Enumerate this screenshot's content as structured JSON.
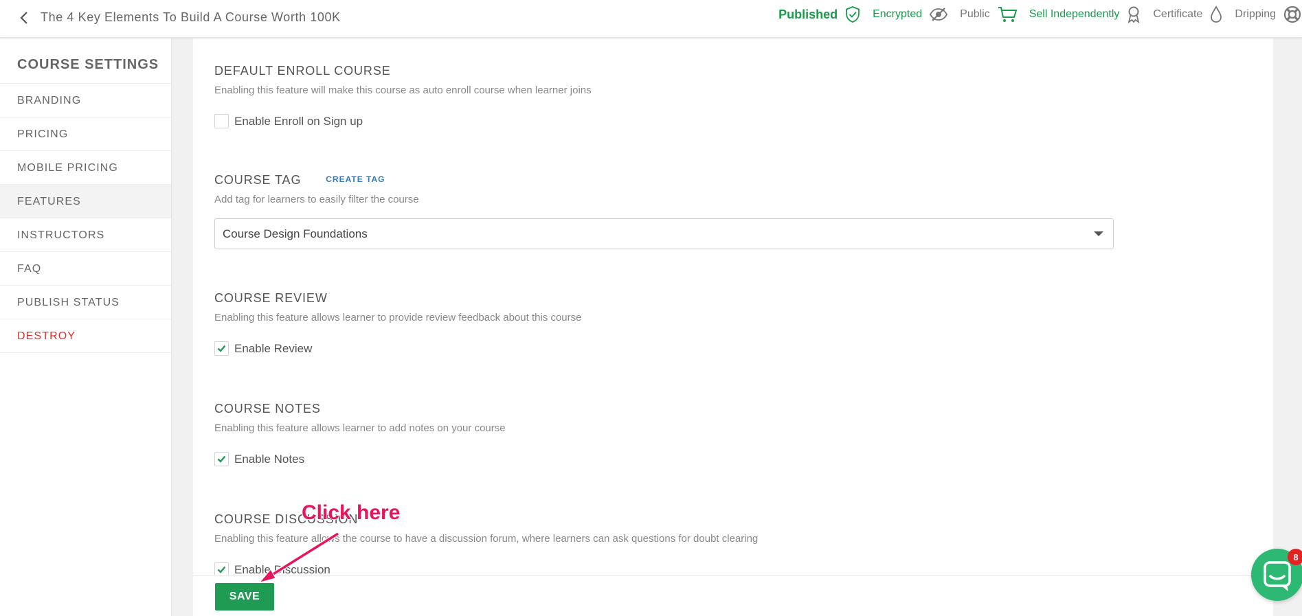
{
  "header": {
    "course_title": "The 4 Key Elements To Build A Course Worth 100K",
    "status": {
      "published": "Published",
      "encrypted": "Encrypted",
      "public": "Public",
      "sell_independently": "Sell Independently",
      "certificate": "Certificate",
      "dripping": "Dripping"
    },
    "icons": [
      "back-arrow-icon",
      "shield-check-icon",
      "eye-slash-icon",
      "shopping-cart-icon",
      "award-ribbon-icon",
      "water-drop-icon",
      "lifebuoy-icon"
    ]
  },
  "sidebar": {
    "title": "COURSE SETTINGS",
    "items": [
      {
        "label": "BRANDING"
      },
      {
        "label": "PRICING"
      },
      {
        "label": "MOBILE PRICING"
      },
      {
        "label": "FEATURES",
        "active": true
      },
      {
        "label": "INSTRUCTORS"
      },
      {
        "label": "FAQ"
      },
      {
        "label": "PUBLISH STATUS"
      },
      {
        "label": "DESTROY"
      }
    ]
  },
  "main": {
    "default_enroll": {
      "title": "DEFAULT ENROLL COURSE",
      "desc": "Enabling this feature will make this course as auto enroll course when learner joins",
      "checkbox_label": "Enable Enroll on Sign up",
      "checked": false
    },
    "course_tag": {
      "title": "COURSE TAG",
      "create_label": "CREATE TAG",
      "desc": "Add tag for learners to easily filter the course",
      "selected": "Course Design Foundations"
    },
    "course_review": {
      "title": "COURSE REVIEW",
      "desc": "Enabling this feature allows learner to provide review feedback about this course",
      "checkbox_label": "Enable Review",
      "checked": true
    },
    "course_notes": {
      "title": "COURSE NOTES",
      "desc": "Enabling this feature allows learner to add notes on your course",
      "checkbox_label": "Enable Notes",
      "checked": true
    },
    "course_discussion": {
      "title": "COURSE DISCUSSION",
      "desc": "Enabling this feature allows the course to have a discussion forum, where learners can ask questions for doubt clearing",
      "checkbox_label": "Enable Discussion",
      "checked": true
    }
  },
  "footer": {
    "save_label": "SAVE"
  },
  "annotation": {
    "text": "Click here",
    "color": "#e8145e"
  },
  "chat": {
    "badge": "8"
  },
  "colors": {
    "accent_green": "#1f9b54",
    "danger": "#e02e2e",
    "link_blue": "#2f7bc4"
  }
}
